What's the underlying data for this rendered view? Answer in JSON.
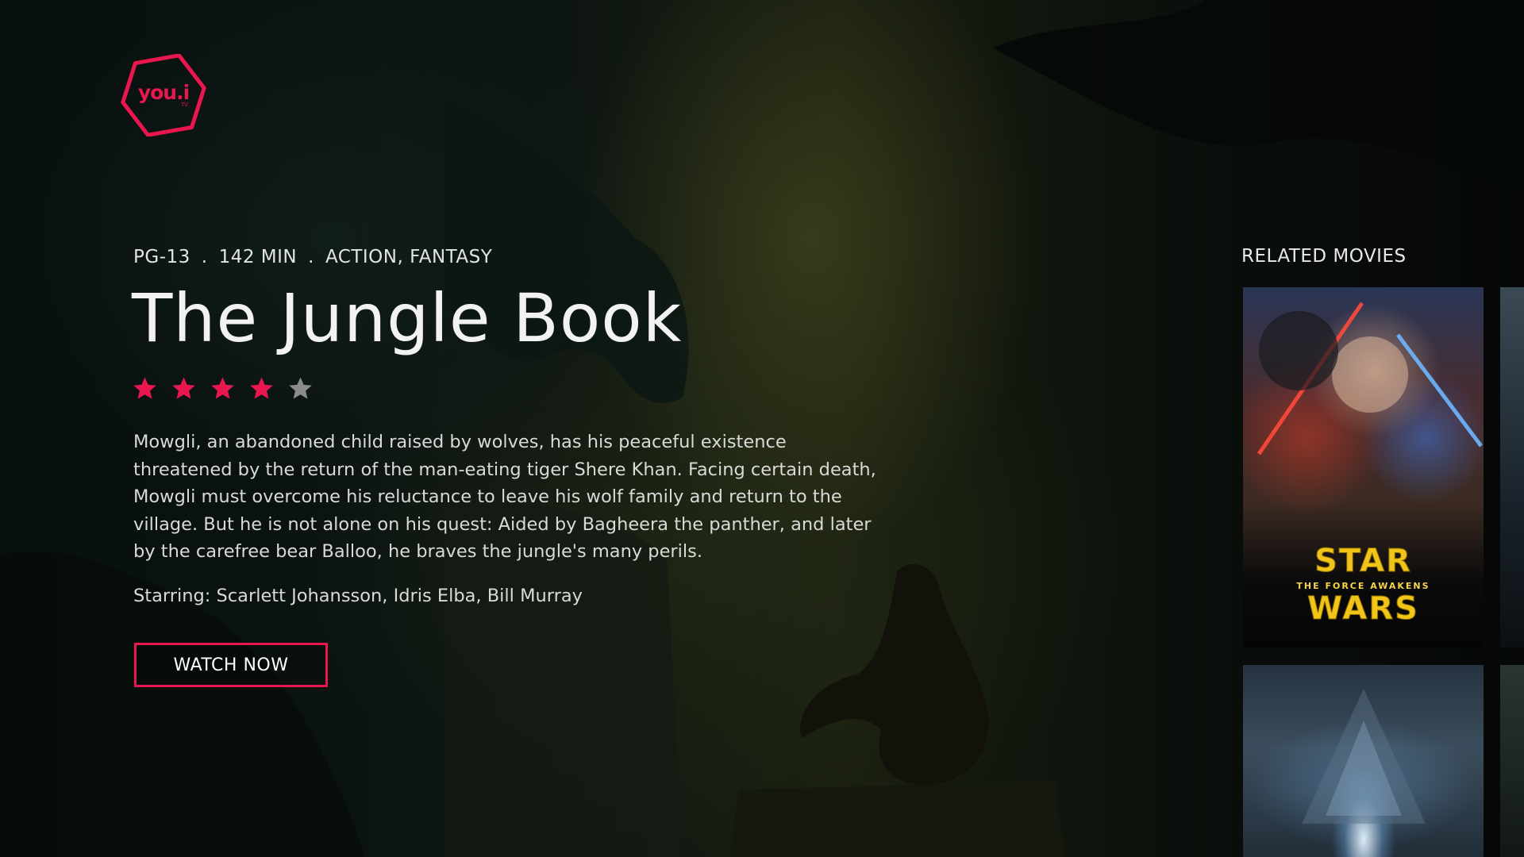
{
  "brand": {
    "logo_text": "you.i",
    "logo_subtext": "TV",
    "accent_color": "#e8174f"
  },
  "movie": {
    "rating_label": "PG-13",
    "runtime": "142 MIN",
    "genres": "ACTION, FANTASY",
    "separator": ".",
    "title": "The Jungle Book",
    "stars": {
      "filled": 4,
      "total": 5
    },
    "synopsis": "Mowgli, an abandoned child raised by wolves, has his peaceful existence threatened by the return of the man-eating tiger Shere Khan. Facing certain death, Mowgli must overcome his reluctance to leave his wolf family and return to the village. But he is not alone on his quest: Aided by Bagheera the panther, and later by the carefree bear Balloo, he braves the jungle's many perils.",
    "starring": "Starring: Scarlett Johansson, Idris Elba, Bill Murray",
    "watch_button_label": "WATCH NOW"
  },
  "related": {
    "heading": "RELATED MOVIES",
    "posters": [
      {
        "name": "star-wars-the-force-awakens",
        "logo_line1": "STAR",
        "logo_tagline": "THE FORCE AWAKENS",
        "logo_line2": "WARS"
      },
      {
        "name": "independence-day"
      }
    ]
  },
  "colors": {
    "star_filled": "#e8174f",
    "star_empty": "#8b8b8b",
    "text": "#e9eaea"
  }
}
